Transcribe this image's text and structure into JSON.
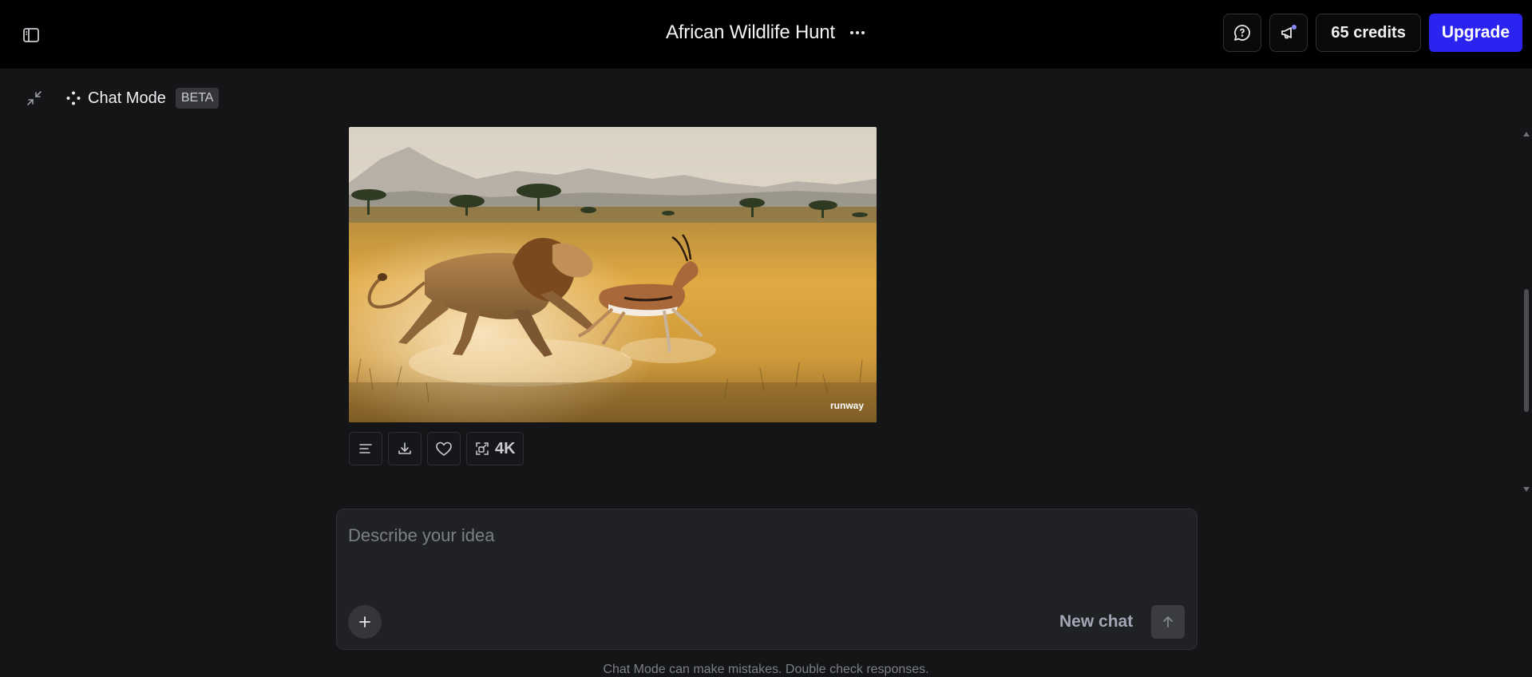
{
  "header": {
    "title": "African Wildlife Hunt",
    "credits_label": "65 credits",
    "upgrade_label": "Upgrade",
    "accent_color": "#2b24f0"
  },
  "mode": {
    "label": "Chat Mode",
    "badge": "BETA"
  },
  "media": {
    "watermark": "runway",
    "quality_label": "4K"
  },
  "composer": {
    "placeholder": "Describe your idea",
    "new_chat_label": "New chat"
  },
  "footer": {
    "disclaimer": "Chat Mode can make mistakes. Double check responses."
  },
  "icons": [
    "sidebar-icon",
    "more-icon",
    "feedback-icon",
    "announcement-icon",
    "collapse-icon",
    "sparkle-icon",
    "details-icon",
    "download-icon",
    "heart-icon",
    "upscale-icon",
    "plus-icon",
    "arrow-up-icon"
  ]
}
